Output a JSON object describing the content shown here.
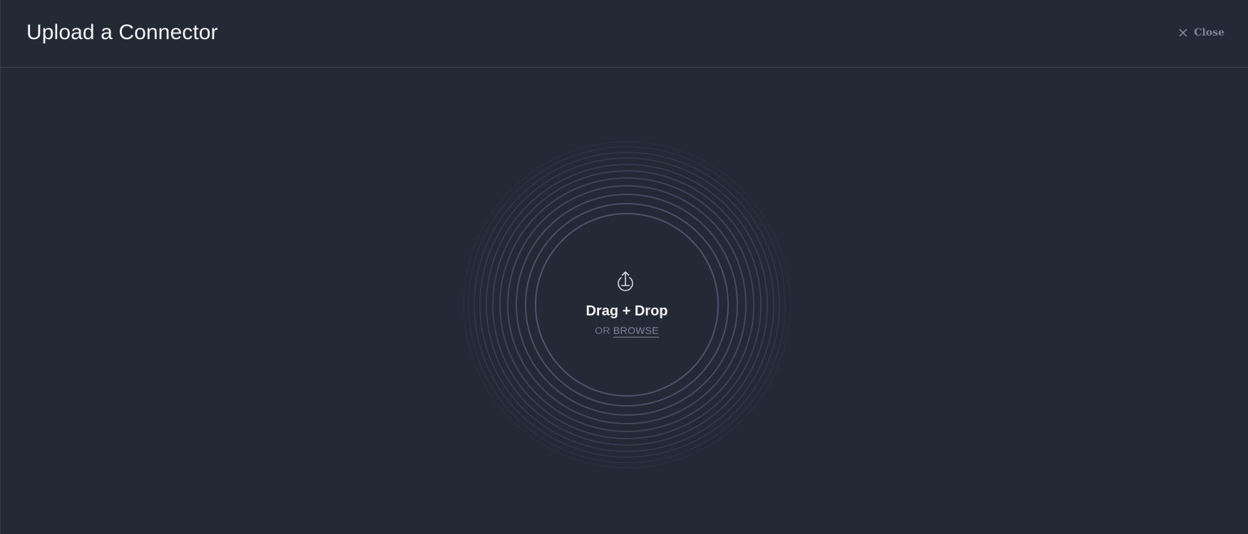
{
  "header": {
    "title": "Upload a Connector",
    "close_label": "Close",
    "close_icon": "close-icon"
  },
  "dropzone": {
    "icon": "upload-icon",
    "title": "Drag + Drop",
    "or_label": "OR",
    "browse_label": "BROWSE"
  },
  "colors": {
    "background": "#242936",
    "divider": "#3f4656",
    "title_text": "#f2f4f8",
    "muted_text": "#6e7689",
    "ring": "#4a5063"
  }
}
